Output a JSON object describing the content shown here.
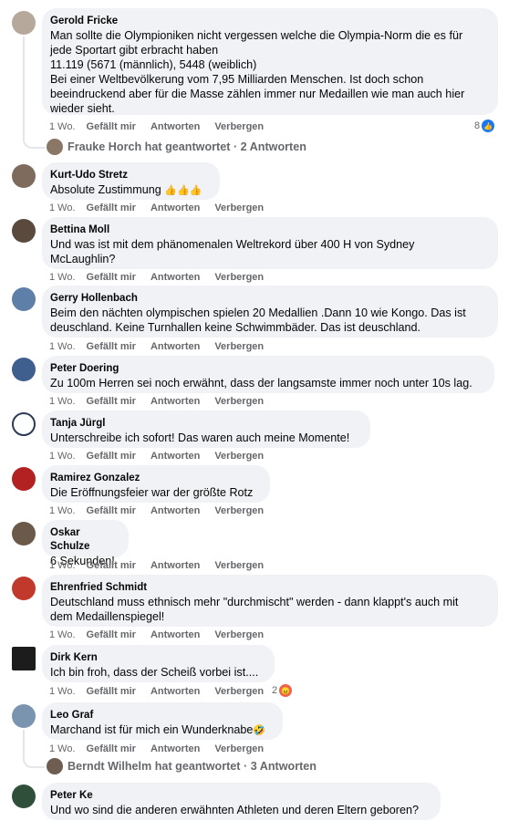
{
  "actions": {
    "time": "1 Wo.",
    "like": "Gefällt mir",
    "reply": "Antworten",
    "hide": "Verbergen"
  },
  "comments": [
    {
      "author": "Gerold Fricke",
      "text": "Man sollte die Olympioniken nicht vergessen welche die Olympia-Norm die es für\njede Sportart gibt erbracht haben\n11.119 (5671 (männlich), 5448 (weiblich)\nBei einer Weltbevölkerung vom 7,95 Milliarden Menschen. Ist doch schon\nbeeindruckend aber für die Masse zählen immer nur Medaillen wie man auch hier\nwieder sieht.",
      "reaction_count": "8",
      "reaction_icon": "like-icon"
    },
    {
      "author": "Kurt-Udo Stretz",
      "text": "Absolute Zustimmung",
      "emoji": "👍👍👍"
    },
    {
      "author": "Bettina Moll",
      "text": "Und was ist mit dem phänomenalen Weltrekord über 400 H von Sydney\nMcLaughlin?"
    },
    {
      "author": "Gerry Hollenbach",
      "text": "Beim den nächten olympischen spielen 20 Medallien .Dann 10 wie Kongo. Das ist\ndeuschland. Keine Turnhallen keine Schwimmbäder. Das ist deuschland."
    },
    {
      "author": "Peter Doering",
      "text": "Zu 100m Herren sei noch erwähnt, dass der langsamste immer noch unter 10s lag."
    },
    {
      "author": "Tanja Jürgl",
      "text": "Unterschreibe ich sofort! Das waren auch meine Momente!"
    },
    {
      "author": "Ramirez Gonzalez",
      "text": "Die Eröffnungsfeier war der größte Rotz"
    },
    {
      "author": "Oskar Schulze",
      "text": "6 Sekunden!"
    },
    {
      "author": "Ehrenfried Schmidt",
      "text": "Deutschland muss ethnisch mehr \"durchmischt\" werden - dann klappt's auch mit\ndem Medaillenspiegel!"
    },
    {
      "author": "Dirk Kern",
      "text": "Ich bin froh, dass der Scheiß vorbei ist....",
      "reaction_count": "2",
      "reaction_icon": "angry-icon"
    },
    {
      "author": "Leo Graf",
      "text": "Marchand ist für mich ein Wunderknabe",
      "emoji": "🤣"
    },
    {
      "author": "Peter Ke",
      "text": "Und wo sind die anderen erwähnten Athleten und deren Eltern geboren?"
    }
  ],
  "replies": [
    {
      "text": "Frauke Horch hat geantwortet · 2 Antworten"
    },
    {
      "text": "Berndt Wilhelm hat geantwortet · 3 Antworten"
    }
  ],
  "colors": {
    "bubble": "#f0f2f5",
    "meta": "#65676b",
    "like": "#1877f2",
    "angry": "#f0624a"
  }
}
